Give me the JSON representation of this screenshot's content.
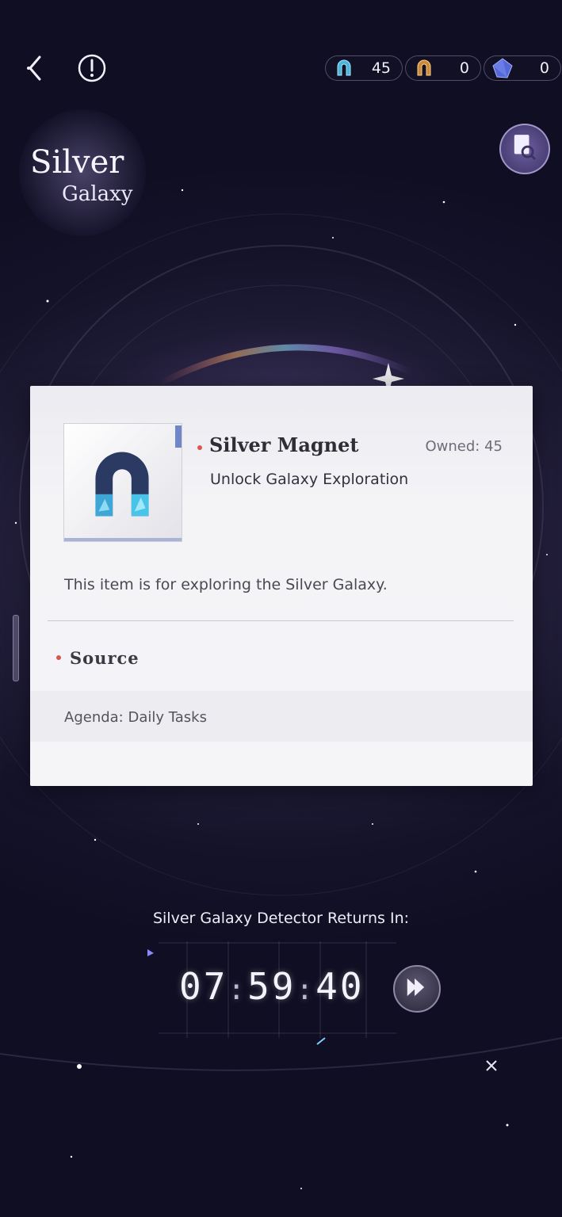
{
  "header": {
    "logo": {
      "line1": "Silver",
      "line2": "Galaxy"
    },
    "resources": [
      {
        "icon": "silver-magnet-icon",
        "value": "45"
      },
      {
        "icon": "gold-magnet-icon",
        "value": "0"
      },
      {
        "icon": "blue-crystal-icon",
        "value": "0"
      }
    ]
  },
  "item_detail": {
    "name": "Silver Magnet",
    "owned": "Owned: 45",
    "subtitle": "Unlock Galaxy Exploration",
    "description": "This item is for exploring the Silver Galaxy.",
    "source_title": "Source",
    "source_item": "Agenda: Daily Tasks"
  },
  "timer": {
    "label": "Silver Galaxy Detector Returns In:",
    "hours": "07",
    "minutes": "59",
    "seconds": "40",
    "separator": ":"
  },
  "colors": {
    "accent_dot": "#d8574e",
    "modal_bg": "#f4f4f7",
    "background": "#1c1934"
  }
}
